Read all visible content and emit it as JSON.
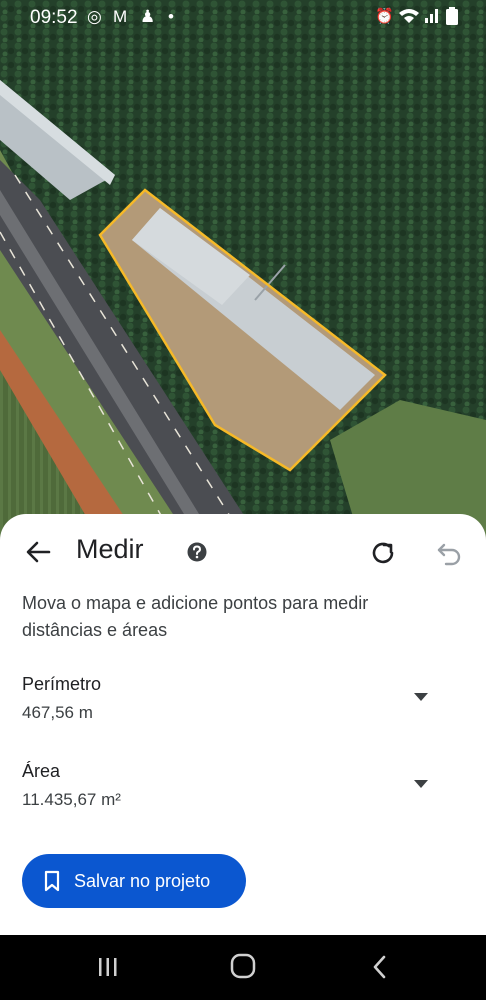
{
  "status_bar": {
    "time": "09:52",
    "left_icons": [
      "whatsapp-icon",
      "gmail-icon",
      "app-icon",
      "dot-icon"
    ],
    "right_icons": [
      "alarm-icon",
      "wifi-icon",
      "signal-icon",
      "battery-icon"
    ]
  },
  "sheet": {
    "title": "Medir",
    "description": "Mova o mapa e adicione pontos para medir distâncias e áreas",
    "perimeter": {
      "label": "Perímetro",
      "value": "467,56 m"
    },
    "area": {
      "label": "Área",
      "value": "11.435,67 m²"
    },
    "save_label": "Salvar no projeto"
  },
  "colors": {
    "accent": "#0b57d0",
    "outline": "#f6b928"
  }
}
